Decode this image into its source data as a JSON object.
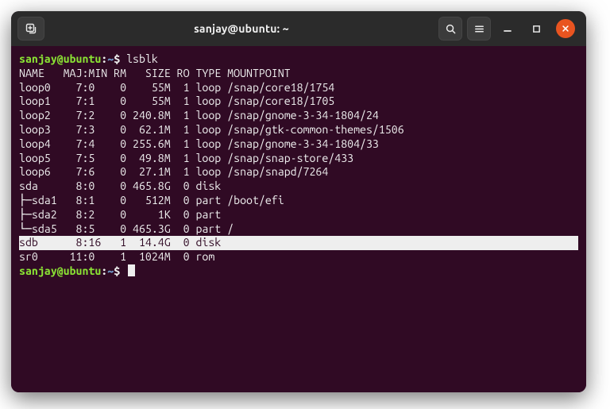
{
  "window": {
    "title": "sanjay@ubuntu: ~"
  },
  "prompt": {
    "user_host": "sanjay@ubuntu",
    "path": "~",
    "symbol": "$"
  },
  "command": "lsblk",
  "header": "NAME   MAJ:MIN RM   SIZE RO TYPE MOUNTPOINT",
  "rows": [
    {
      "text": "loop0    7:0    0    55M  1 loop /snap/core18/1754",
      "hl": false
    },
    {
      "text": "loop1    7:1    0    55M  1 loop /snap/core18/1705",
      "hl": false
    },
    {
      "text": "loop2    7:2    0 240.8M  1 loop /snap/gnome-3-34-1804/24",
      "hl": false
    },
    {
      "text": "loop3    7:3    0  62.1M  1 loop /snap/gtk-common-themes/1506",
      "hl": false
    },
    {
      "text": "loop4    7:4    0 255.6M  1 loop /snap/gnome-3-34-1804/33",
      "hl": false
    },
    {
      "text": "loop5    7:5    0  49.8M  1 loop /snap/snap-store/433",
      "hl": false
    },
    {
      "text": "loop6    7:6    0  27.1M  1 loop /snap/snapd/7264",
      "hl": false
    },
    {
      "text": "sda      8:0    0 465.8G  0 disk ",
      "hl": false
    },
    {
      "text": "├─sda1   8:1    0   512M  0 part /boot/efi",
      "hl": false
    },
    {
      "text": "├─sda2   8:2    0     1K  0 part ",
      "hl": false
    },
    {
      "text": "└─sda5   8:5    0 465.3G  0 part /",
      "hl": false
    },
    {
      "text": "sdb      8:16   1  14.4G  0 disk ",
      "hl": true
    },
    {
      "text": "sr0     11:0    1  1024M  0 rom  ",
      "hl": false
    }
  ]
}
